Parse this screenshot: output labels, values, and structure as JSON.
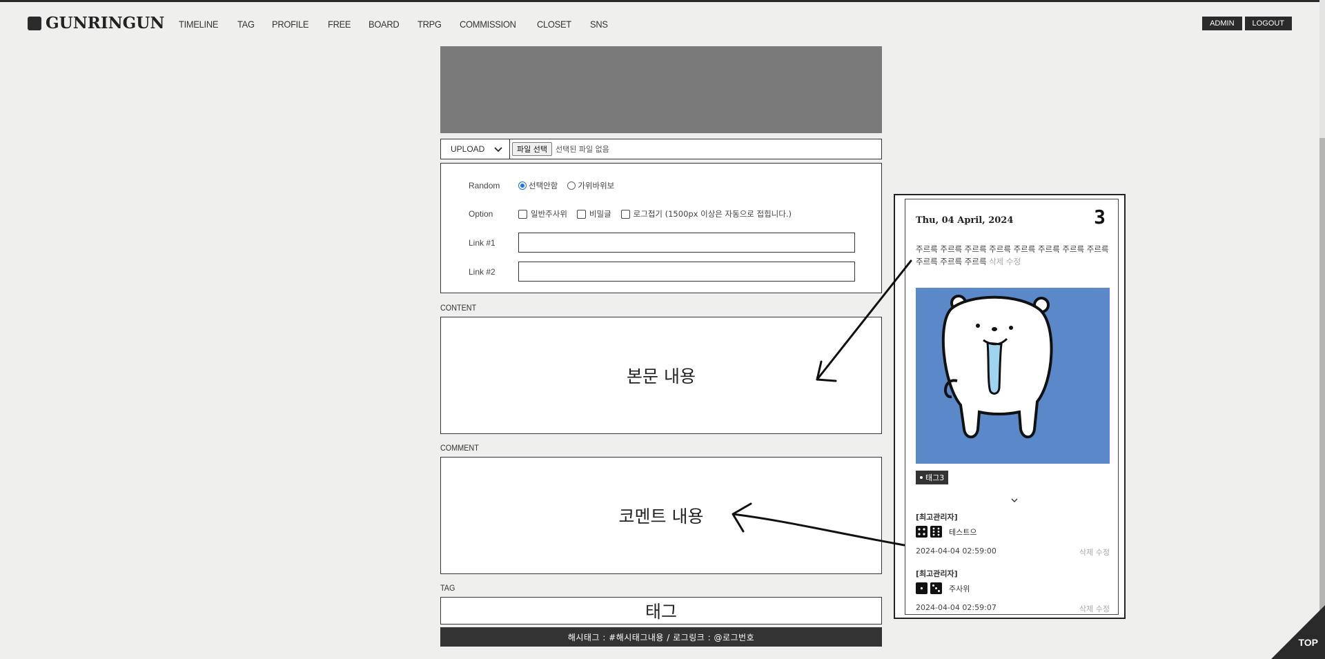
{
  "brand": {
    "name": "GUNRINGUN"
  },
  "nav": [
    "TIMELINE",
    "TAG",
    "PROFILE",
    "FREE",
    "BOARD",
    "TRPG",
    "COMMISSION",
    "CLOSET",
    "SNS"
  ],
  "admin": {
    "admin_label": "ADMIN",
    "logout_label": "LOGOUT"
  },
  "upload": {
    "select_value": "UPLOAD",
    "file_button": "파일 선택",
    "file_status": "선택된 파일 없음"
  },
  "options": {
    "random_label": "Random",
    "random_choices": [
      "선택안함",
      "가위바위보"
    ],
    "random_selected": "선택안함",
    "option_label": "Option",
    "option_choices": [
      "일반주사위",
      "비밀글",
      "로그접기 (1500px 이상은 자동으로 접힙니다.)"
    ],
    "link1_label": "Link #1",
    "link2_label": "Link #2"
  },
  "content": {
    "label": "CONTENT",
    "placeholder_text": "본문 내용"
  },
  "comment": {
    "label": "COMMENT",
    "placeholder_text": "코멘트 내용"
  },
  "tag": {
    "label": "TAG",
    "placeholder_text": "태그"
  },
  "hint": "해시태그 : #해시태그내용 / 로그링크 : @로그번호",
  "card": {
    "date": "Thu, 04 April, 2024",
    "number": "3",
    "body": "주르륵 주르륵 주르륵 주르륵 주르륵 주르륵 주르륵 주르륵 주르륵 주르륵 주르륵",
    "actions": "삭제 수정",
    "image_bg": "#5a88c9",
    "tag": "태그3",
    "comments": [
      {
        "author": "[최고관리자]",
        "text": "테스트으",
        "time": "2024-04-04 02:59:00",
        "actions": "삭제 수정"
      },
      {
        "author": "[최고관리자]",
        "text": "주사위",
        "time": "2024-04-04 02:59:07",
        "actions": "삭제 수정"
      }
    ]
  },
  "top_button": "TOP"
}
